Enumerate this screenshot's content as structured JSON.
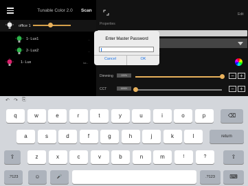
{
  "left_panel": {
    "title": "Tunable Color 2.0",
    "scan_label": "Scan",
    "devices": [
      {
        "label": "office 1",
        "color": "#e8e8e8"
      },
      {
        "label": "1- Lux1",
        "color": "#2db34a",
        "trailing": "..."
      },
      {
        "label": "2- Lux2",
        "color": "#2db34a",
        "trailing": "..."
      },
      {
        "label": "1- Lux",
        "color": "#d9206b",
        "trailing": "lux..."
      }
    ]
  },
  "right_panel": {
    "edit_label": "Edit",
    "properties_label": "Properties",
    "dimming_label": "Dimming",
    "dimming_value": "100%",
    "dimming_level": 1.0,
    "cct_label": "CCT",
    "cct_value": "1650K",
    "cct_level": 0.0,
    "field_2_text": "...",
    "minus_label": "−",
    "plus_label": "+"
  },
  "dialog": {
    "title": "Enter Master Password",
    "password_value": "",
    "cancel_label": "Cancel",
    "ok_label": "OK"
  },
  "keyboard": {
    "toolbar": {
      "undo": "↶",
      "redo": "↷",
      "paste": "⎘"
    },
    "row1": [
      "q",
      "w",
      "e",
      "r",
      "t",
      "y",
      "u",
      "i",
      "o",
      "p"
    ],
    "row2": [
      "a",
      "s",
      "d",
      "f",
      "g",
      "h",
      "j",
      "k",
      "l"
    ],
    "row3": [
      "z",
      "x",
      "c",
      "v",
      "b",
      "n",
      "m"
    ],
    "row3_punct": [
      "!",
      ",",
      "?",
      "."
    ],
    "backspace_label": "⌫",
    "return_label": "return",
    "shift_label": "⇧",
    "numbers_label": ".?123",
    "emoji_label": "☺",
    "mic_label": "🎤",
    "space_label": "",
    "hide_label": "⌨"
  },
  "colors": {
    "accent_orange": "#e8b15c",
    "accent_blue": "#1a73e8",
    "green_bulb": "#2db34a",
    "pink_bulb": "#d9206b"
  }
}
